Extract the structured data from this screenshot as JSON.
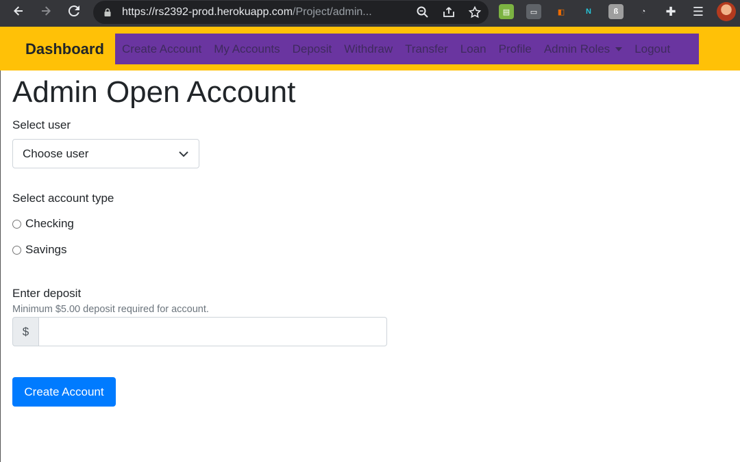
{
  "browser": {
    "url_host": "https://rs2392-prod.herokuapp.com",
    "url_path": "/Project/admin..."
  },
  "navbar": {
    "brand": "Dashboard",
    "links": [
      {
        "label": "Create Account"
      },
      {
        "label": "My Accounts"
      },
      {
        "label": "Deposit"
      },
      {
        "label": "Withdraw"
      },
      {
        "label": "Transfer"
      },
      {
        "label": "Loan"
      },
      {
        "label": "Profile"
      },
      {
        "label": "Admin Roles"
      },
      {
        "label": "Logout"
      }
    ],
    "bg_color": "#ffc107",
    "links_bg_color": "#6a35a0"
  },
  "page": {
    "title": "Admin Open Account",
    "select_user_label": "Select user",
    "select_user_value": "Choose user",
    "account_type_label": "Select account type",
    "account_types": [
      {
        "label": "Checking"
      },
      {
        "label": "Savings"
      }
    ],
    "deposit_label": "Enter deposit",
    "deposit_help": "Minimum $5.00 deposit required for account.",
    "currency_symbol": "$",
    "deposit_value": "",
    "submit_label": "Create Account",
    "primary_color": "#007bff"
  }
}
